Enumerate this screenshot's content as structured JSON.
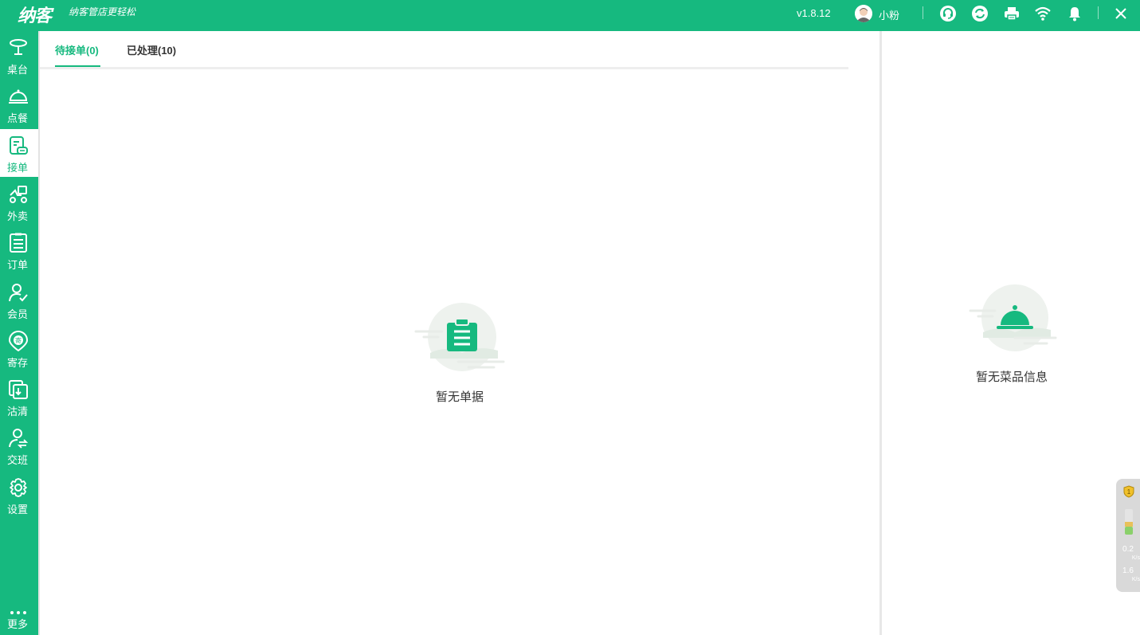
{
  "app": {
    "logo": "纳客",
    "slogan": "纳客管店更轻松",
    "version": "v1.8.12",
    "username": "小粉",
    "accent_color": "#16b97f"
  },
  "topbar_icons": [
    "headset-icon",
    "sync-icon",
    "printer-icon",
    "wifi-icon",
    "bell-icon",
    "close-icon"
  ],
  "sidebar": {
    "items": [
      {
        "label": "桌台",
        "icon": "table-icon"
      },
      {
        "label": "点餐",
        "icon": "cloche-icon"
      },
      {
        "label": "接单",
        "icon": "receive-order-icon"
      },
      {
        "label": "外卖",
        "icon": "delivery-icon"
      },
      {
        "label": "订单",
        "icon": "order-list-icon"
      },
      {
        "label": "会员",
        "icon": "member-icon"
      },
      {
        "label": "寄存",
        "icon": "deposit-icon"
      },
      {
        "label": "沽清",
        "icon": "soldout-icon"
      },
      {
        "label": "交班",
        "icon": "shift-handover-icon"
      },
      {
        "label": "设置",
        "icon": "gear-icon"
      }
    ],
    "active_index": 2,
    "more_label": "更多"
  },
  "tabs": [
    {
      "label": "待接单(0)",
      "active": true
    },
    {
      "label": "已处理(10)",
      "active": false
    }
  ],
  "main": {
    "empty_text": "暂无单据"
  },
  "right_panel": {
    "empty_text": "暂无菜品信息"
  },
  "float_widget": {
    "upload_speed": "0.2",
    "download_speed": "1.6",
    "unit": "K/s"
  }
}
